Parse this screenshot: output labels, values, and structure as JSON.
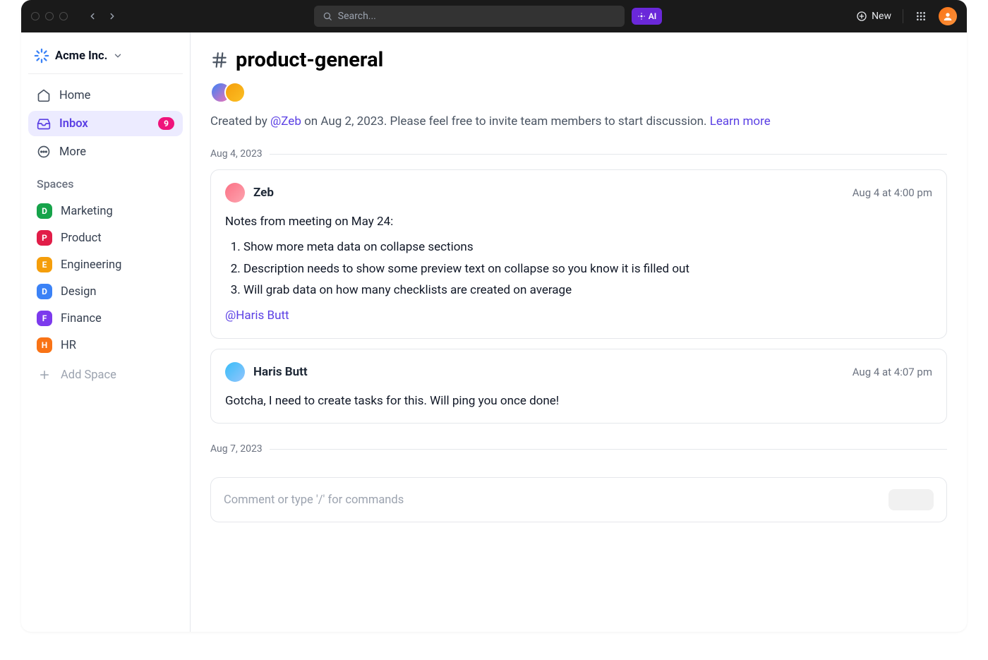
{
  "topbar": {
    "search_placeholder": "Search...",
    "ai_label": "AI",
    "new_label": "New"
  },
  "workspace": {
    "name": "Acme Inc."
  },
  "nav": {
    "home": "Home",
    "inbox": "Inbox",
    "inbox_badge": "9",
    "more": "More"
  },
  "spaces_label": "Spaces",
  "spaces": [
    {
      "initial": "D",
      "label": "Marketing",
      "color": "#16a34a"
    },
    {
      "initial": "P",
      "label": "Product",
      "color": "#e11d48"
    },
    {
      "initial": "E",
      "label": "Engineering",
      "color": "#f59e0b"
    },
    {
      "initial": "D",
      "label": "Design",
      "color": "#3b82f6"
    },
    {
      "initial": "F",
      "label": "Finance",
      "color": "#7c3aed"
    },
    {
      "initial": "H",
      "label": "HR",
      "color": "#f97316"
    }
  ],
  "add_space_label": "Add Space",
  "channel": {
    "name": "product-general",
    "created_prefix": "Created by ",
    "created_by": "@Zeb",
    "created_rest": " on Aug 2, 2023. Please feel free to invite team members to start discussion. ",
    "learn_more": "Learn more"
  },
  "separators": {
    "d1": "Aug 4, 2023",
    "d2": "Aug 7, 2023"
  },
  "messages": [
    {
      "author": "Zeb",
      "time": "Aug 4 at 4:00 pm",
      "lead": "Notes from meeting on May 24:",
      "items": [
        "Show more meta data on collapse sections",
        "Description needs to show some preview text on collapse so you know it is filled out",
        "Will grab data on how many checklists are created on average"
      ],
      "mention": "@Haris Butt"
    },
    {
      "author": "Haris Butt",
      "time": "Aug 4 at 4:07 pm",
      "body": "Gotcha, I need to create tasks for this. Will ping you once done!"
    }
  ],
  "composer": {
    "placeholder": "Comment or type '/' for commands"
  }
}
